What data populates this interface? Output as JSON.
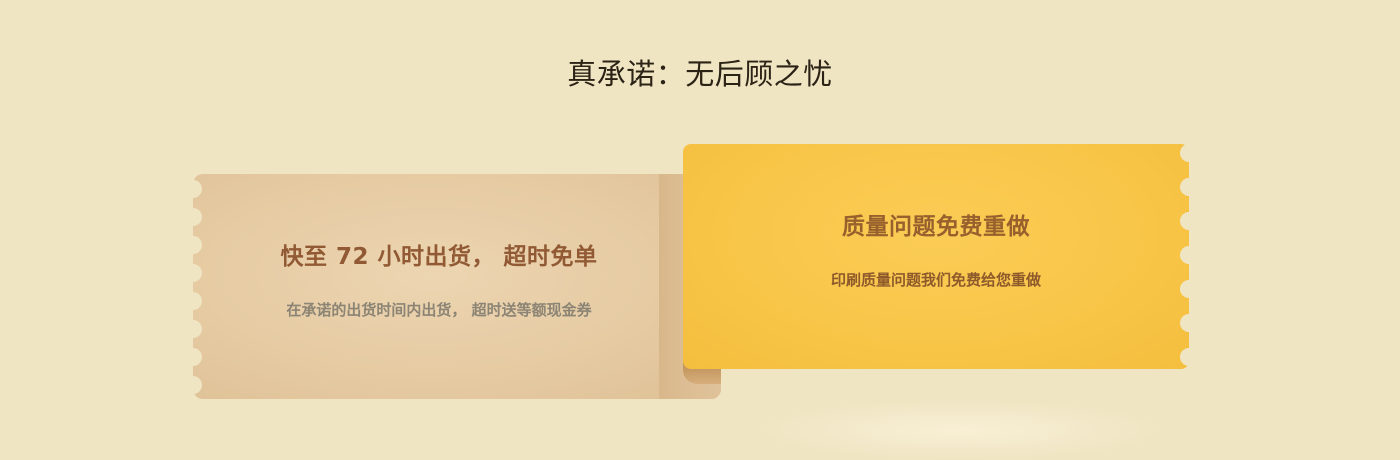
{
  "section": {
    "title": "真承诺：无后顾之忧"
  },
  "coupons": [
    {
      "title": "快至 72 小时出货， 超时免单",
      "subtitle": "在承诺的出货时间内出货， 超时送等额现金券",
      "color": "#e6cba3",
      "title_color": "#915a35"
    },
    {
      "title": "质量问题免费重做",
      "subtitle": "印刷质量问题我们免费给您重做",
      "color": "#f8c547",
      "title_color": "#98602d"
    }
  ],
  "colors": {
    "background": "#f0e5c3",
    "heading": "#2b2316"
  }
}
